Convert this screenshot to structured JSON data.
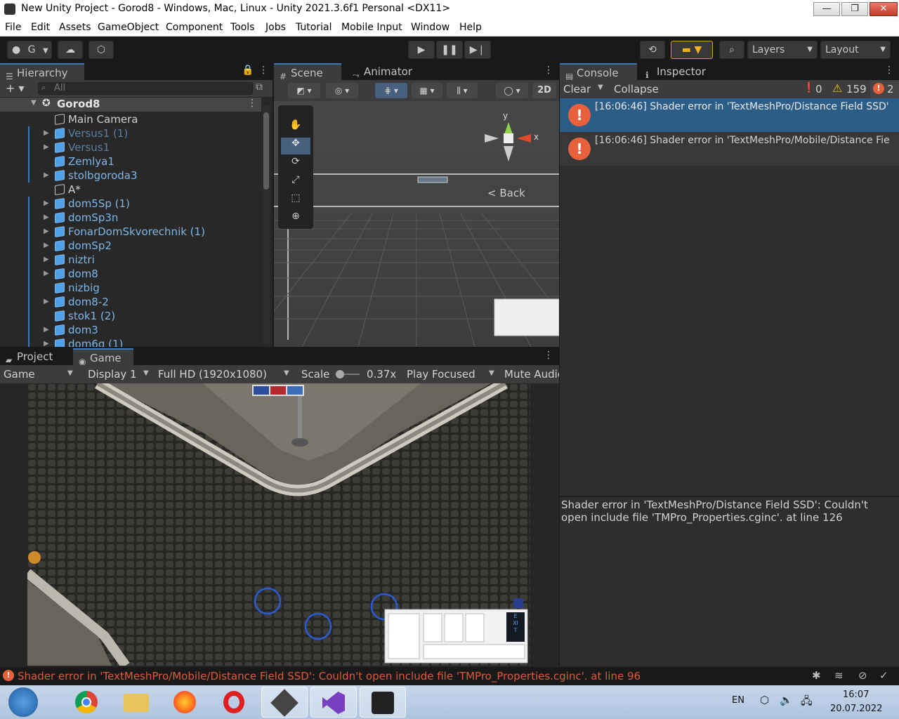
{
  "window": {
    "title": "New Unity Project - Gorod8 - Windows, Mac, Linux - Unity 2021.3.6f1 Personal <DX11>",
    "min": "—",
    "max": "❐",
    "close": "✕"
  },
  "menu": [
    "File",
    "Edit",
    "Assets",
    "GameObject",
    "Component",
    "Tools",
    "Jobs",
    "Tutorial",
    "Mobile Input",
    "Window",
    "Help"
  ],
  "toolbar": {
    "account": "G",
    "layers": "Layers",
    "layout": "Layout"
  },
  "hierarchy": {
    "tab": "Hierarchy",
    "search_placeholder": "All",
    "scene": "Gorod8",
    "items": [
      {
        "label": "Main Camera",
        "style": "white",
        "arrow": false,
        "chev": false,
        "icon": "gray"
      },
      {
        "label": "Versus1 (1)",
        "style": "dim",
        "arrow": true,
        "chev": true,
        "icon": "blue"
      },
      {
        "label": "Versus1",
        "style": "dim",
        "arrow": true,
        "chev": true,
        "icon": "blue"
      },
      {
        "label": "Zemlya1",
        "style": "blue",
        "arrow": false,
        "chev": false,
        "icon": "blue"
      },
      {
        "label": "stolbgoroda3",
        "style": "blue",
        "arrow": true,
        "chev": true,
        "icon": "blue"
      },
      {
        "label": "A*",
        "style": "white",
        "arrow": false,
        "chev": false,
        "icon": "gray"
      },
      {
        "label": "dom5Sp (1)",
        "style": "blue",
        "arrow": true,
        "chev": true,
        "icon": "blue"
      },
      {
        "label": "domSp3n",
        "style": "blue",
        "arrow": true,
        "chev": false,
        "icon": "blue"
      },
      {
        "label": "FonarDomSkvorechnik (1)",
        "style": "blue",
        "arrow": true,
        "chev": true,
        "icon": "blue"
      },
      {
        "label": "domSp2",
        "style": "blue",
        "arrow": true,
        "chev": false,
        "icon": "blue"
      },
      {
        "label": "niztri",
        "style": "blue",
        "arrow": true,
        "chev": false,
        "icon": "blue"
      },
      {
        "label": "dom8",
        "style": "blue",
        "arrow": true,
        "chev": false,
        "icon": "blue"
      },
      {
        "label": "nizbig",
        "style": "blue",
        "arrow": false,
        "chev": false,
        "icon": "blue"
      },
      {
        "label": "dom8-2",
        "style": "blue",
        "arrow": true,
        "chev": false,
        "icon": "blue"
      },
      {
        "label": "stok1 (2)",
        "style": "blue",
        "arrow": false,
        "chev": false,
        "icon": "blue"
      },
      {
        "label": "dom3",
        "style": "blue",
        "arrow": true,
        "chev": false,
        "icon": "blue"
      },
      {
        "label": "dom6g (1)",
        "style": "blue",
        "arrow": true,
        "chev": true,
        "icon": "blue"
      }
    ]
  },
  "scene": {
    "tab_scene": "Scene",
    "tab_animator": "Animator",
    "mode_2d": "2D",
    "back_label": "Back",
    "gizmo_y": "y",
    "gizmo_x": "x"
  },
  "console": {
    "tab_console": "Console",
    "tab_inspector": "Inspector",
    "clear": "Clear",
    "collapse": "Collapse",
    "info_count": "0",
    "warn_count": "159",
    "error_count": "2",
    "entries": [
      "[16:06:46] Shader error in 'TextMeshPro/Distance Field SSD'",
      "[16:06:46] Shader error in 'TextMeshPro/Mobile/Distance Fie"
    ],
    "detail": "Shader error in 'TextMeshPro/Distance Field SSD': Couldn't open include file 'TMPro_Properties.cginc'. at line 126"
  },
  "game": {
    "tab_project": "Project",
    "tab_game": "Game",
    "game_dropdown": "Game",
    "display": "Display 1",
    "resolution": "Full HD (1920x1080)",
    "scale_label": "Scale",
    "scale_value": "0.37x",
    "play_focused": "Play Focused",
    "mute": "Mute Audio",
    "exit_label": "EXIT"
  },
  "status": "Shader error in 'TextMeshPro/Mobile/Distance Field SSD': Couldn't open include file 'TMPro_Properties.cginc'. at line 96",
  "tray": {
    "lang": "EN",
    "time": "16:07",
    "date": "20.07.2022"
  }
}
